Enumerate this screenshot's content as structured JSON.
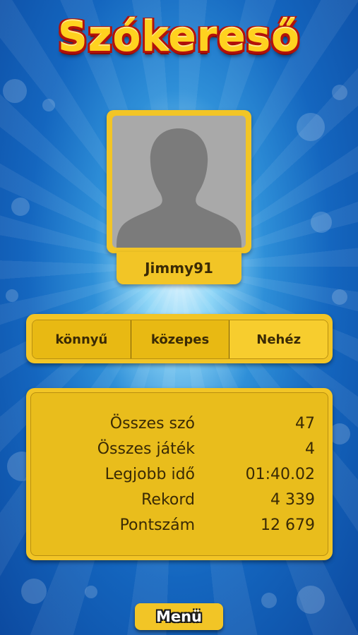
{
  "title": "Szókereső",
  "player": {
    "name": "Jimmy91",
    "avatar_icon": "person-silhouette-icon"
  },
  "difficulty_tabs": [
    {
      "label": "könnyű",
      "active": false
    },
    {
      "label": "közepes",
      "active": false
    },
    {
      "label": "Nehéz",
      "active": true
    }
  ],
  "stats": [
    {
      "label": "Összes szó",
      "value": "47"
    },
    {
      "label": "Összes játék",
      "value": "4"
    },
    {
      "label": "Legjobb idő",
      "value": "01:40.02"
    },
    {
      "label": "Rekord",
      "value": "4 339"
    },
    {
      "label": "Pontszám",
      "value": "12 679"
    }
  ],
  "menu_button": {
    "label": "Menü"
  },
  "colors": {
    "panel": "#f2c526",
    "title": "#ffd21f",
    "title_outline": "#b3120a",
    "background": "#1466bf"
  }
}
